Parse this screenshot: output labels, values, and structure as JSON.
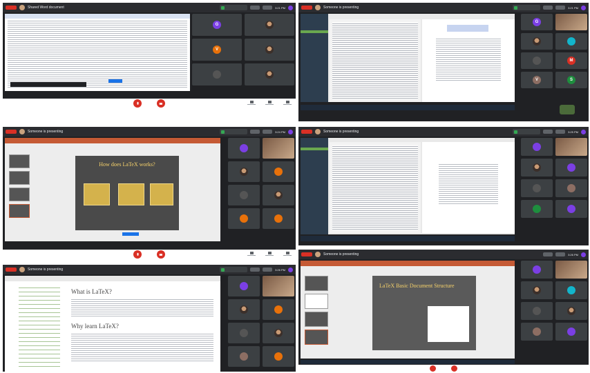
{
  "panels": [
    {
      "presenter_text": "Shared Word document",
      "time": "3:21 PM"
    },
    {
      "presenter_text": "Someone is presenting",
      "time": "3:21 PM"
    },
    {
      "presenter_text": "Someone is presenting",
      "time": "3:24 PM"
    },
    {
      "presenter_text": "Someone is presenting",
      "time": "3:25 PM"
    },
    {
      "presenter_text": "Someone is presenting",
      "time": "3:26 PM"
    },
    {
      "presenter_text": "Someone is presenting",
      "time": "3:26 PM"
    }
  ],
  "slides": {
    "how_title": "How does LaTeX works?",
    "what_title": "What is LaTeX?",
    "why_title": "Why learn LaTeX?",
    "doc_title": "LaTeX Basic Document Structure"
  },
  "participants_a": [
    "G",
    "",
    "V",
    "",
    "",
    ""
  ],
  "participants_b": [
    "G",
    "",
    "M",
    "",
    "V",
    "S"
  ],
  "colors": {
    "accent_red": "#d93025",
    "purple": "#7b3fe4",
    "orange": "#e8710a",
    "teal": "#12b5cb",
    "green": "#1e8e3e",
    "brown": "#8d6e63"
  }
}
